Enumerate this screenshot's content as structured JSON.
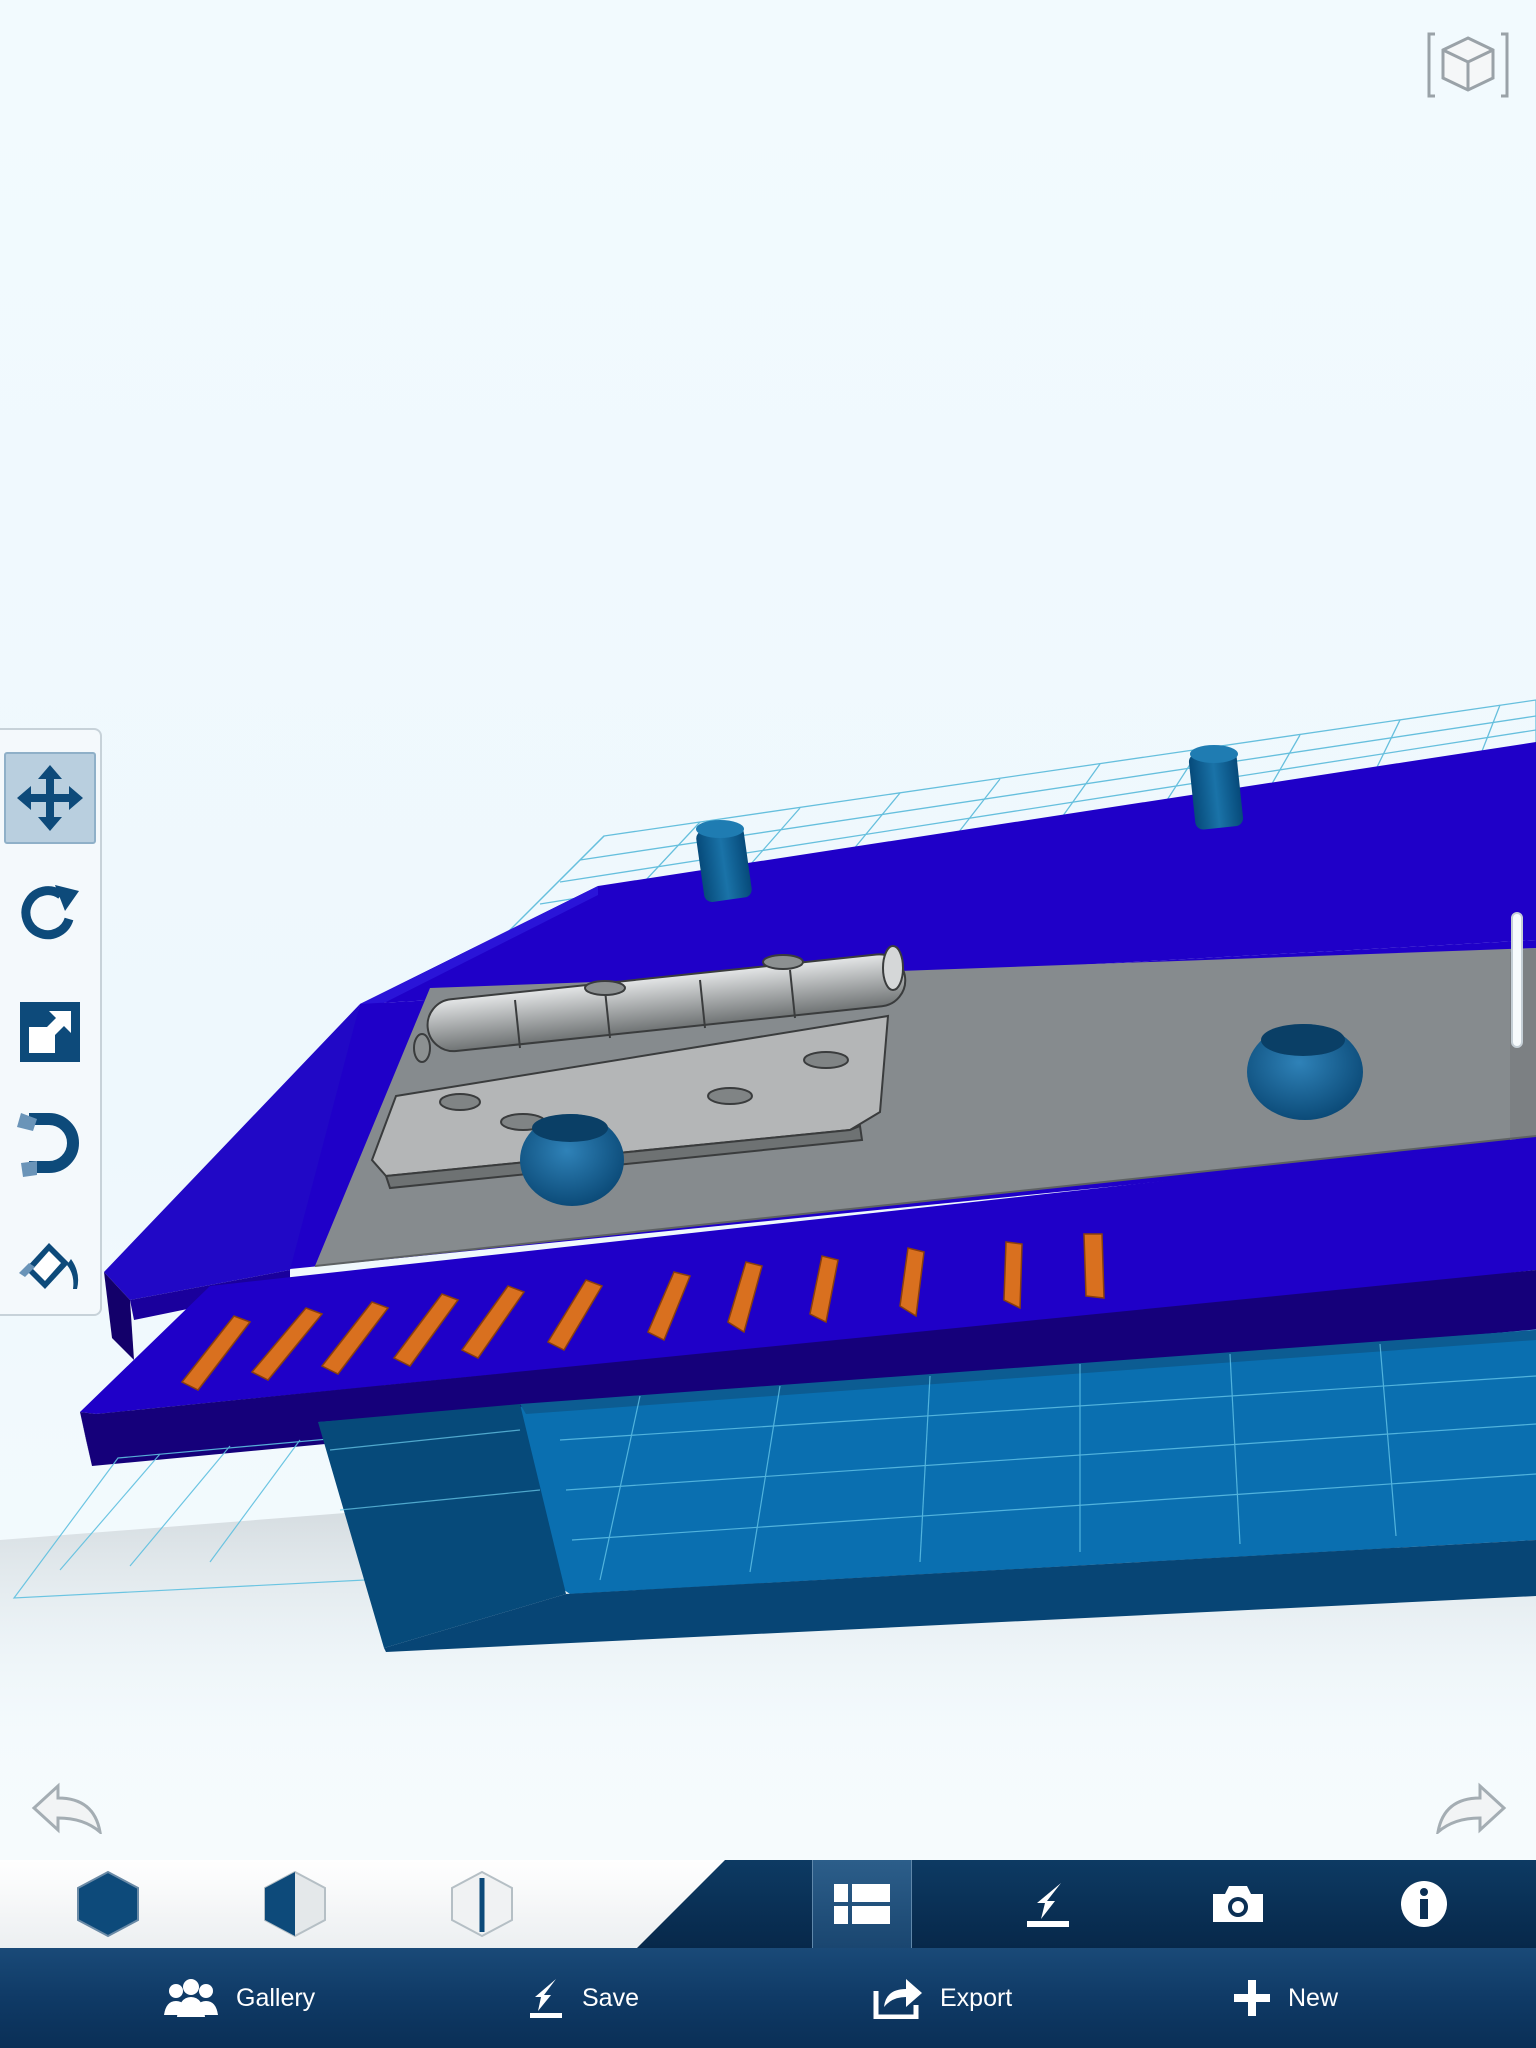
{
  "app": {
    "accent": "#0d4a7a",
    "viewport_bg": "#eef8fd"
  },
  "scene": {
    "objects": [
      "blue-base-plate",
      "gray-inner-plate",
      "metal-hinge",
      "orange-teeth",
      "blue-pegs",
      "blue-rings",
      "blue-tray",
      "work-grid"
    ],
    "colors": {
      "blue_plate": "#1f00c8",
      "dark_blue": "#15007a",
      "gray_plate": "#868b8e",
      "hinge": "#a8aaab",
      "orange": "#d9701f",
      "teal": "#0a5a8e",
      "tray": "#0a6fb0",
      "grid": "#4fb6d8"
    }
  },
  "left_toolbar": {
    "tools": [
      {
        "name": "move",
        "icon": "move-icon",
        "active": true
      },
      {
        "name": "rotate",
        "icon": "rotate-icon",
        "active": false
      },
      {
        "name": "scale",
        "icon": "scale-icon",
        "active": false
      },
      {
        "name": "snap",
        "icon": "magnet-icon",
        "active": false
      },
      {
        "name": "material",
        "icon": "paint-bucket-icon",
        "active": false
      }
    ]
  },
  "history": {
    "undo_icon": "undo-icon",
    "redo_icon": "redo-icon"
  },
  "style_buttons": [
    {
      "name": "shaded",
      "icon": "hexagon-solid-icon"
    },
    {
      "name": "shaded-edges",
      "icon": "hexagon-half-icon"
    },
    {
      "name": "wireframe",
      "icon": "hexagon-outline-icon"
    }
  ],
  "action_buttons": [
    {
      "name": "list",
      "icon": "list-icon",
      "active": true
    },
    {
      "name": "import",
      "icon": "import-icon",
      "active": false
    },
    {
      "name": "camera",
      "icon": "camera-icon",
      "active": false
    },
    {
      "name": "info",
      "icon": "info-icon",
      "active": false
    }
  ],
  "menu": {
    "gallery": "Gallery",
    "save": "Save",
    "export": "Export",
    "new": "New"
  }
}
